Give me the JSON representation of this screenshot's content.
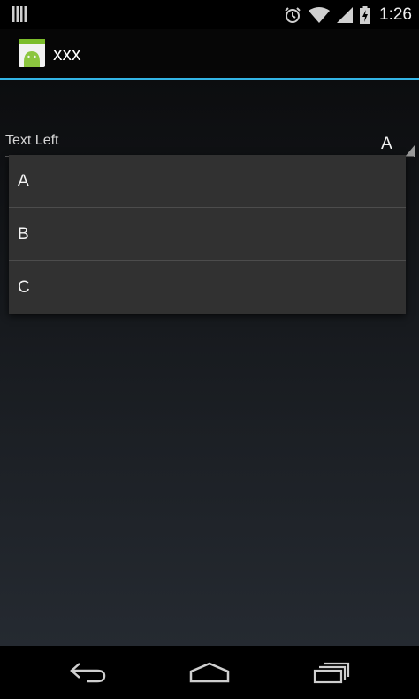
{
  "status_bar": {
    "time": "1:26",
    "icons": [
      "signal-bars-icon",
      "alarm-icon",
      "wifi-icon",
      "cell-signal-icon",
      "battery-charging-icon"
    ]
  },
  "action_bar": {
    "title": "xxx",
    "icon": "android-app-icon",
    "accent_color": "#33b5e5"
  },
  "form": {
    "label": "Text Left",
    "spinner_selected": "A"
  },
  "dropdown": {
    "items": [
      "A",
      "B",
      "C"
    ]
  },
  "nav_bar": {
    "icons": [
      "back-icon",
      "home-icon",
      "recent-apps-icon"
    ]
  }
}
